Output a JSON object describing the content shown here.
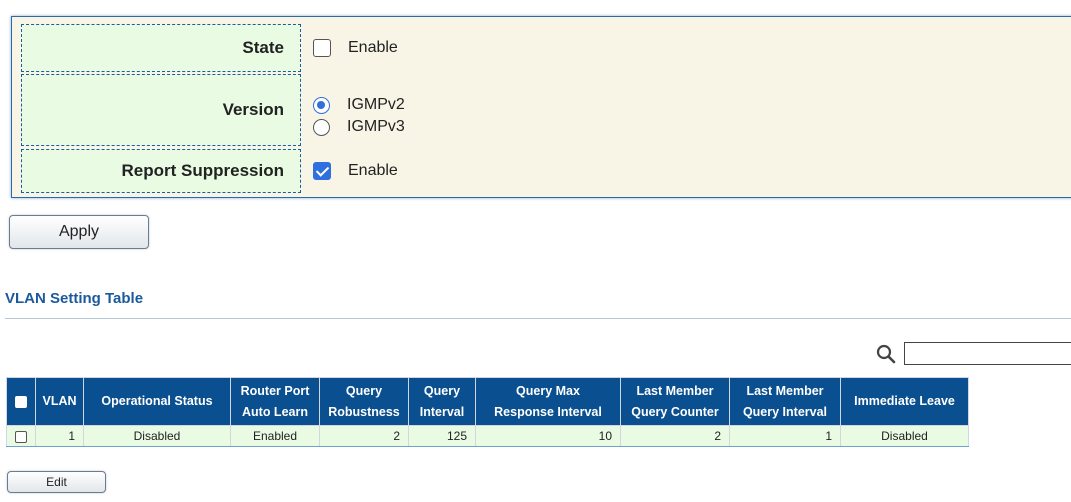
{
  "settings": {
    "state": {
      "label": "State",
      "option_label": "Enable",
      "checked": false
    },
    "version": {
      "label": "Version",
      "options": [
        {
          "label": "IGMPv2",
          "selected": true
        },
        {
          "label": "IGMPv3",
          "selected": false
        }
      ]
    },
    "report_suppression": {
      "label": "Report Suppression",
      "option_label": "Enable",
      "checked": true
    }
  },
  "apply_label": "Apply",
  "vlan_table": {
    "title": "VLAN Setting Table",
    "search": {
      "value": "",
      "icon": "search-icon"
    },
    "columns": [
      "VLAN",
      "Operational Status",
      [
        "Router Port",
        "Auto Learn"
      ],
      [
        "Query",
        "Robustness"
      ],
      [
        "Query",
        "Interval"
      ],
      [
        "Query Max",
        "Response Interval"
      ],
      [
        "Last Member",
        "Query Counter"
      ],
      [
        "Last Member",
        "Query Interval"
      ],
      "Immediate Leave"
    ],
    "rows": [
      {
        "vlan": "1",
        "operational_status": "Disabled",
        "router_port_auto_learn": "Enabled",
        "query_robustness": "2",
        "query_interval": "125",
        "query_max_response_interval": "10",
        "last_member_query_counter": "2",
        "last_member_query_interval": "1",
        "immediate_leave": "Disabled"
      }
    ]
  },
  "edit_label": "Edit",
  "colors": {
    "header_bg": "#0a4f8f",
    "label_bg": "#e9fbe3",
    "panel_bg": "#f8f5e6",
    "title_color": "#1a5a9c",
    "accent": "#2f6fdf"
  }
}
